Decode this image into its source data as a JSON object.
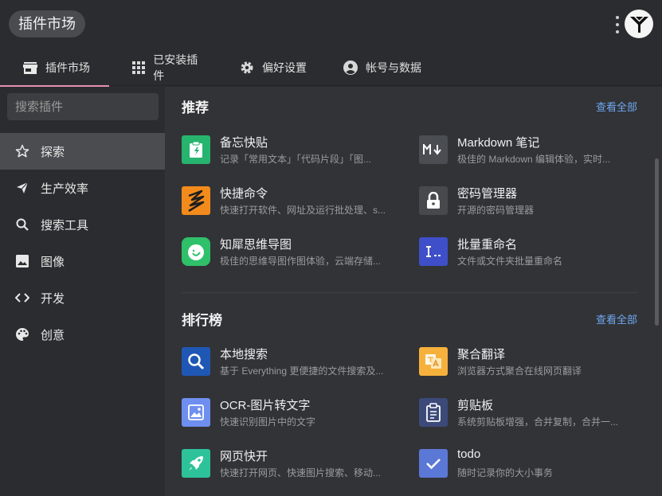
{
  "app": {
    "title": "插件市场"
  },
  "tabs": [
    {
      "label": "插件市场",
      "icon": "store-icon",
      "active": true
    },
    {
      "label": "已安装插件",
      "icon": "grid-icon",
      "active": false
    },
    {
      "label": "偏好设置",
      "icon": "gear-icon",
      "active": false
    },
    {
      "label": "帐号与数据",
      "icon": "account-icon",
      "active": false
    }
  ],
  "search": {
    "placeholder": "搜索插件"
  },
  "sidebar": {
    "items": [
      {
        "label": "探索",
        "icon": "star-icon",
        "active": true
      },
      {
        "label": "生产效率",
        "icon": "send-icon",
        "active": false
      },
      {
        "label": "搜索工具",
        "icon": "search-icon",
        "active": false
      },
      {
        "label": "图像",
        "icon": "image-icon",
        "active": false
      },
      {
        "label": "开发",
        "icon": "code-icon",
        "active": false
      },
      {
        "label": "创意",
        "icon": "palette-icon",
        "active": false
      }
    ]
  },
  "recommend": {
    "title": "推荐",
    "view_all": "查看全部",
    "plugins": [
      {
        "name": "备忘快贴",
        "desc": "记录「常用文本」「代码片段」「图...",
        "icon": "clipboard-icon",
        "color": "#27b46e"
      },
      {
        "name": "Markdown 笔记",
        "desc": "极佳的 Markdown 编辑体验，实时...",
        "icon": "markdown-icon",
        "color": "#4a4d52"
      },
      {
        "name": "快捷命令",
        "desc": "快速打开软件、网址及运行批处理、s...",
        "icon": "lightning-icon",
        "color": "#f28b1c"
      },
      {
        "name": "密码管理器",
        "desc": "开源的密码管理器",
        "icon": "lock-icon",
        "color": "#48494c"
      },
      {
        "name": "知犀思维导图",
        "desc": "极佳的思维导图作图体验，云端存储...",
        "icon": "rhino-icon",
        "color": "#2fc06a"
      },
      {
        "name": "批量重命名",
        "desc": "文件或文件夹批量重命名",
        "icon": "rename-icon",
        "color": "#3f4fc9"
      }
    ]
  },
  "ranking": {
    "title": "排行榜",
    "view_all": "查看全部",
    "plugins": [
      {
        "name": "本地搜索",
        "desc": "基于 Everything 更便捷的文件搜索及...",
        "icon": "magnifier-icon",
        "color": "#1f57b5"
      },
      {
        "name": "聚合翻译",
        "desc": "浏览器方式聚合在线网页翻译",
        "icon": "translate-icon",
        "color": "#f6b13c"
      },
      {
        "name": "OCR-图片转文字",
        "desc": "快速识别图片中的文字",
        "icon": "ocr-image-icon",
        "color": "#6f8ff0"
      },
      {
        "name": "剪贴板",
        "desc": "系统剪贴板增强，合并复制，合并一...",
        "icon": "clipboard-board-icon",
        "color": "#3c4a7a"
      },
      {
        "name": "网页快开",
        "desc": "快速打开网页、快速图片搜索、移动...",
        "icon": "rocket-icon",
        "color": "#2ec29a"
      },
      {
        "name": "todo",
        "desc": "随时记录你的大小事务",
        "icon": "check-icon",
        "color": "#5b78d6"
      }
    ]
  }
}
